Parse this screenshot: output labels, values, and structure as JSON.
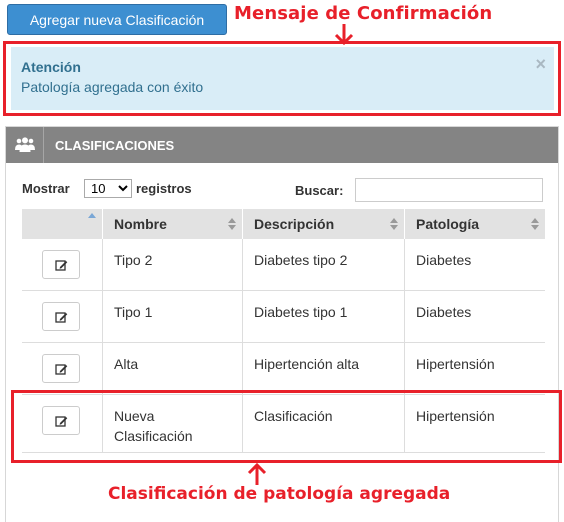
{
  "toolbar": {
    "add_button_label": "Agregar nueva Clasificación"
  },
  "annotations": {
    "top_label": "Mensaje de Confirmación",
    "bottom_label": "Clasificación de patología agregada",
    "color": "#e8202a"
  },
  "alert": {
    "title": "Atención",
    "message": "Patología agregada con éxito",
    "close_symbol": "×"
  },
  "panel": {
    "icon": "users-icon",
    "title": "CLASIFICACIONES"
  },
  "controls": {
    "show_label": "Mostrar",
    "page_size": "10",
    "page_size_options": [
      "10"
    ],
    "entries_label": "registros",
    "search_label": "Buscar:",
    "search_value": ""
  },
  "table": {
    "columns": [
      "",
      "Nombre",
      "Descripción",
      "Patología"
    ],
    "rows": [
      {
        "nombre": "Tipo 2",
        "descripcion": "Diabetes tipo 2",
        "patologia": "Diabetes"
      },
      {
        "nombre": "Tipo 1",
        "descripcion": "Diabetes tipo 1",
        "patologia": "Diabetes"
      },
      {
        "nombre": "Alta",
        "descripcion": "Hipertención alta",
        "patologia": "Hipertensión"
      },
      {
        "nombre": "Nueva\nClasificación",
        "descripcion": "Clasificación",
        "patologia": "Hipertensión"
      }
    ]
  },
  "colors": {
    "primary": "#3d8fd1",
    "alert_bg": "#d9edf7",
    "alert_text": "#31708f",
    "panel_header": "#848484"
  }
}
